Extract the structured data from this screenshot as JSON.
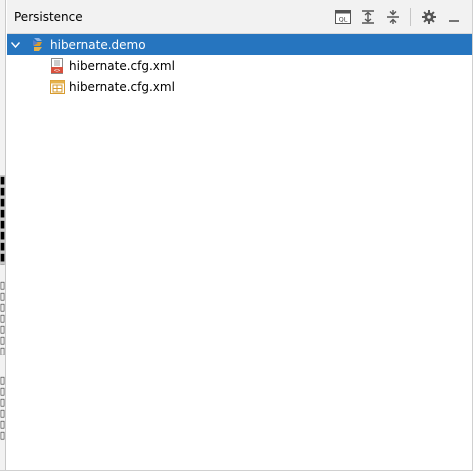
{
  "panel": {
    "title": "Persistence"
  },
  "toolbar": {
    "buttons": [
      {
        "name": "jpa-console-button",
        "icon": "ql-console-icon",
        "glyph": "QL"
      },
      {
        "name": "expand-all-button",
        "icon": "expand-all-icon"
      },
      {
        "name": "collapse-all-button",
        "icon": "collapse-all-icon"
      },
      {
        "name": "settings-button",
        "icon": "gear-icon"
      },
      {
        "name": "hide-button",
        "icon": "minimize-icon"
      }
    ]
  },
  "tree": {
    "root": {
      "label": "hibernate.demo",
      "icon": "module-icon",
      "expanded": true,
      "selected": true
    },
    "children": [
      {
        "label": "hibernate.cfg.xml",
        "icon": "xml-config-file-icon"
      },
      {
        "label": "hibernate.cfg.xml",
        "icon": "hibernate-session-factory-icon"
      }
    ]
  },
  "left_strip": {
    "tabs": [
      {
        "name": "tool-window-tab-1"
      },
      {
        "name": "tool-window-tab-2"
      },
      {
        "name": "tool-window-tab-3"
      }
    ]
  },
  "colors": {
    "selection": "#2675bf",
    "header_bg": "#f2f2f2",
    "icon_gray": "#555555",
    "hibernate_orange": "#d79b2e",
    "hibernate_blue": "#5a7ec8"
  }
}
